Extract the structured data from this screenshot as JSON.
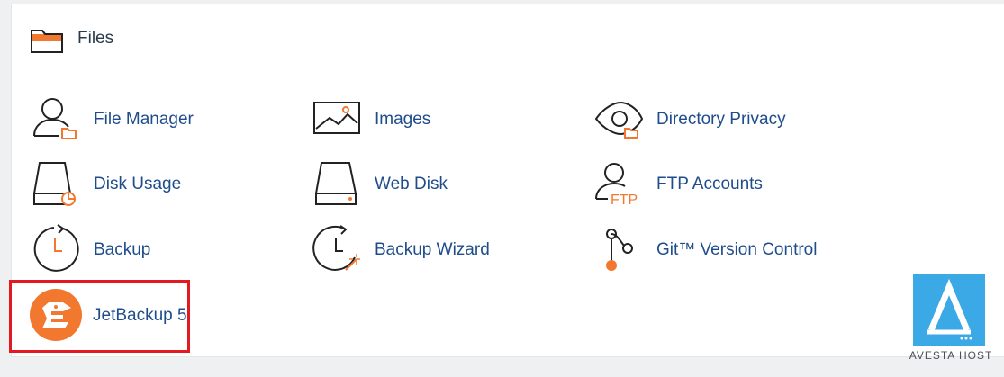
{
  "section": {
    "title": "Files",
    "icon": "folder-icon"
  },
  "items": [
    {
      "label": "File Manager",
      "icon": "file-manager-icon"
    },
    {
      "label": "Images",
      "icon": "image-icon"
    },
    {
      "label": "Directory Privacy",
      "icon": "eye-folder-icon"
    },
    {
      "label": "Disk Usage",
      "icon": "disk-usage-icon"
    },
    {
      "label": "Web Disk",
      "icon": "web-disk-icon"
    },
    {
      "label": "FTP Accounts",
      "icon": "ftp-user-icon"
    },
    {
      "label": "Backup",
      "icon": "clock-arrow-icon"
    },
    {
      "label": "Backup Wizard",
      "icon": "clock-wand-icon"
    },
    {
      "label": "Git™ Version Control",
      "icon": "git-branch-icon"
    },
    {
      "label": "JetBackup 5",
      "icon": "jetbackup-logo-icon"
    }
  ],
  "watermark": {
    "text": "AVESTA HOST"
  },
  "colors": {
    "accent": "#f27830",
    "link": "#1f4d8c",
    "highlight": "#e2191f",
    "watermark_bg": "#3aa9e6"
  }
}
